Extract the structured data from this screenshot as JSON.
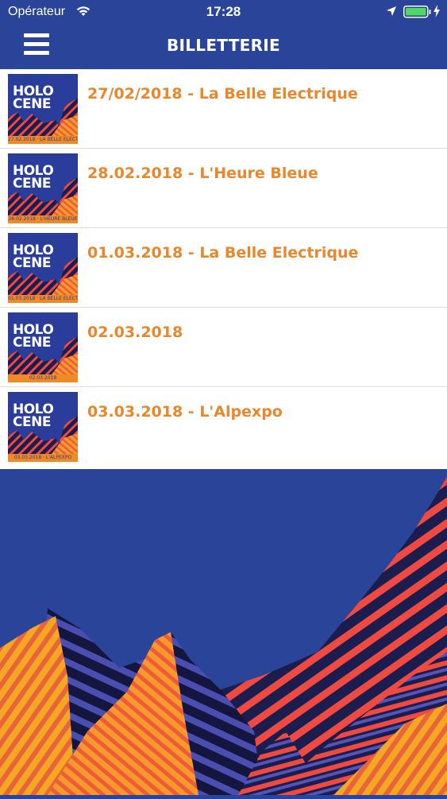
{
  "status_bar": {
    "carrier": "Opérateur",
    "time": "17:28"
  },
  "header": {
    "title": "BILLETTERIE"
  },
  "events": [
    {
      "title": "27/02/2018 - La Belle Electrique",
      "thumb_logo_1": "HOLO",
      "thumb_logo_2": "CENE",
      "thumb_band": "27.02.2018 · LA BELLE ELECTRIQUE"
    },
    {
      "title": "28.02.2018 - L'Heure Bleue",
      "thumb_logo_1": "HOLO",
      "thumb_logo_2": "CENE",
      "thumb_band": "28.02.2018 · L'HEURE BLEUE"
    },
    {
      "title": "01.03.2018 - La Belle Electrique",
      "thumb_logo_1": "HOLO",
      "thumb_logo_2": "CENE",
      "thumb_band": "01.03.2018 · LA BELLE ELECTRIQUE"
    },
    {
      "title": "02.03.2018",
      "thumb_logo_1": "HOLO",
      "thumb_logo_2": "CENE",
      "thumb_band": "02.03.2018"
    },
    {
      "title": "03.03.2018 - L'Alpexpo",
      "thumb_logo_1": "HOLO",
      "thumb_logo_2": "CENE",
      "thumb_band": "03.03.2018 · L'ALPEXPO"
    }
  ],
  "colors": {
    "brand_blue": "#2a449a",
    "accent_orange": "#e8872b"
  },
  "icons": {
    "menu": "hamburger-menu-icon",
    "wifi": "wifi-icon",
    "location": "location-arrow-icon",
    "battery": "battery-icon",
    "charging": "charging-bolt-icon"
  }
}
